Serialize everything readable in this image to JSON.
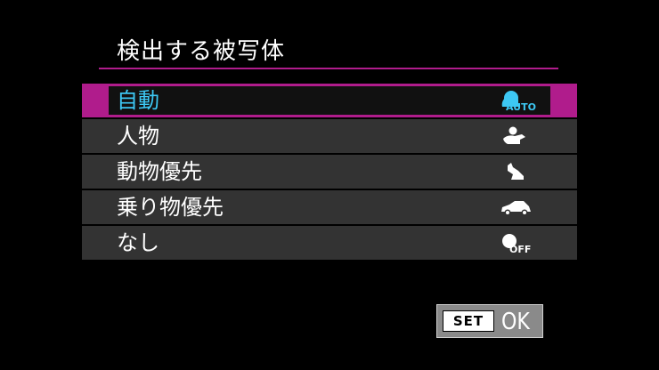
{
  "header": {
    "title": "検出する被写体"
  },
  "menu": {
    "selected_index": 0,
    "items": [
      {
        "label": "自動",
        "icon": "auto-detect-icon",
        "icon_text": "AUTO"
      },
      {
        "label": "人物",
        "icon": "person-icon"
      },
      {
        "label": "動物優先",
        "icon": "animal-icon"
      },
      {
        "label": "乗り物優先",
        "icon": "vehicle-icon"
      },
      {
        "label": "なし",
        "icon": "detect-off-icon",
        "icon_text": "OFF"
      }
    ]
  },
  "footer": {
    "set_label": "SET",
    "ok_label": "OK"
  },
  "colors": {
    "accent": "#b01c8c",
    "selected_text": "#3dc8f4",
    "row_bg": "#333333"
  }
}
